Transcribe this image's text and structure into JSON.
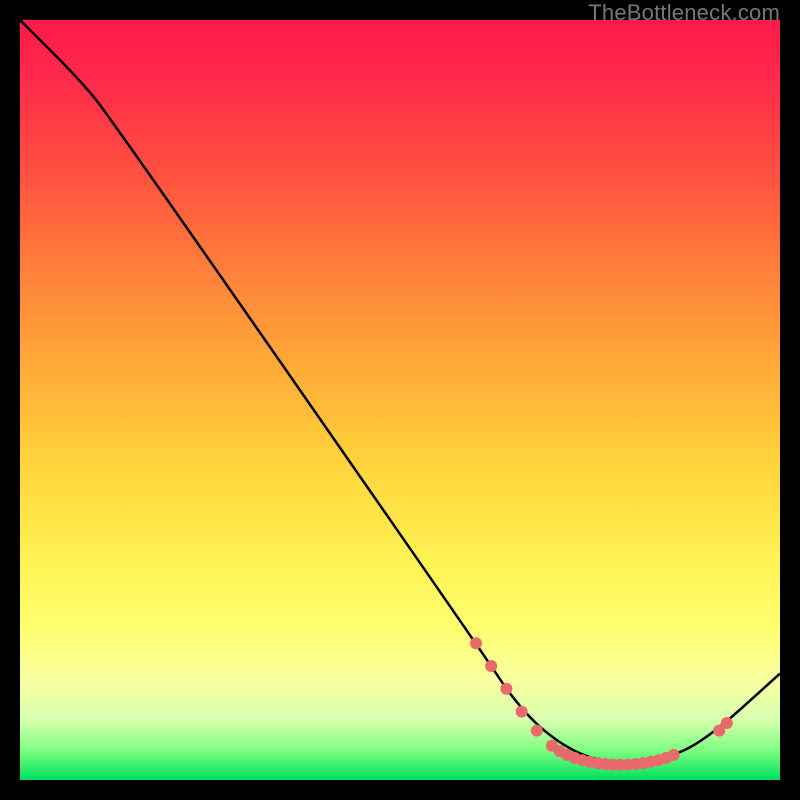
{
  "watermark": "TheBottleneck.com",
  "chart_data": {
    "type": "line",
    "title": "",
    "xlabel": "",
    "ylabel": "",
    "xlim": [
      0,
      100
    ],
    "ylim": [
      0,
      100
    ],
    "grid": false,
    "series": [
      {
        "name": "bottleneck-curve",
        "color": "#000000",
        "points": [
          {
            "x": 0,
            "y": 100
          },
          {
            "x": 8,
            "y": 92
          },
          {
            "x": 12,
            "y": 87
          },
          {
            "x": 60,
            "y": 18
          },
          {
            "x": 66,
            "y": 9
          },
          {
            "x": 72,
            "y": 4
          },
          {
            "x": 78,
            "y": 2
          },
          {
            "x": 84,
            "y": 2.5
          },
          {
            "x": 90,
            "y": 5
          },
          {
            "x": 100,
            "y": 14
          }
        ]
      },
      {
        "name": "markers",
        "color": "#e86a6a",
        "type": "scatter",
        "points": [
          {
            "x": 60,
            "y": 18
          },
          {
            "x": 62,
            "y": 15
          },
          {
            "x": 64,
            "y": 12
          },
          {
            "x": 66,
            "y": 9
          },
          {
            "x": 68,
            "y": 6.5
          },
          {
            "x": 70,
            "y": 4.5
          },
          {
            "x": 71,
            "y": 3.8
          },
          {
            "x": 72,
            "y": 3.3
          },
          {
            "x": 73,
            "y": 2.9
          },
          {
            "x": 74,
            "y": 2.6
          },
          {
            "x": 75,
            "y": 2.4
          },
          {
            "x": 76,
            "y": 2.2
          },
          {
            "x": 77,
            "y": 2.1
          },
          {
            "x": 78,
            "y": 2.0
          },
          {
            "x": 79,
            "y": 2.0
          },
          {
            "x": 80,
            "y": 2.0
          },
          {
            "x": 81,
            "y": 2.1
          },
          {
            "x": 82,
            "y": 2.2
          },
          {
            "x": 83,
            "y": 2.4
          },
          {
            "x": 84,
            "y": 2.6
          },
          {
            "x": 85,
            "y": 2.9
          },
          {
            "x": 86,
            "y": 3.3
          },
          {
            "x": 92,
            "y": 6.5
          },
          {
            "x": 93,
            "y": 7.5
          }
        ]
      }
    ]
  }
}
